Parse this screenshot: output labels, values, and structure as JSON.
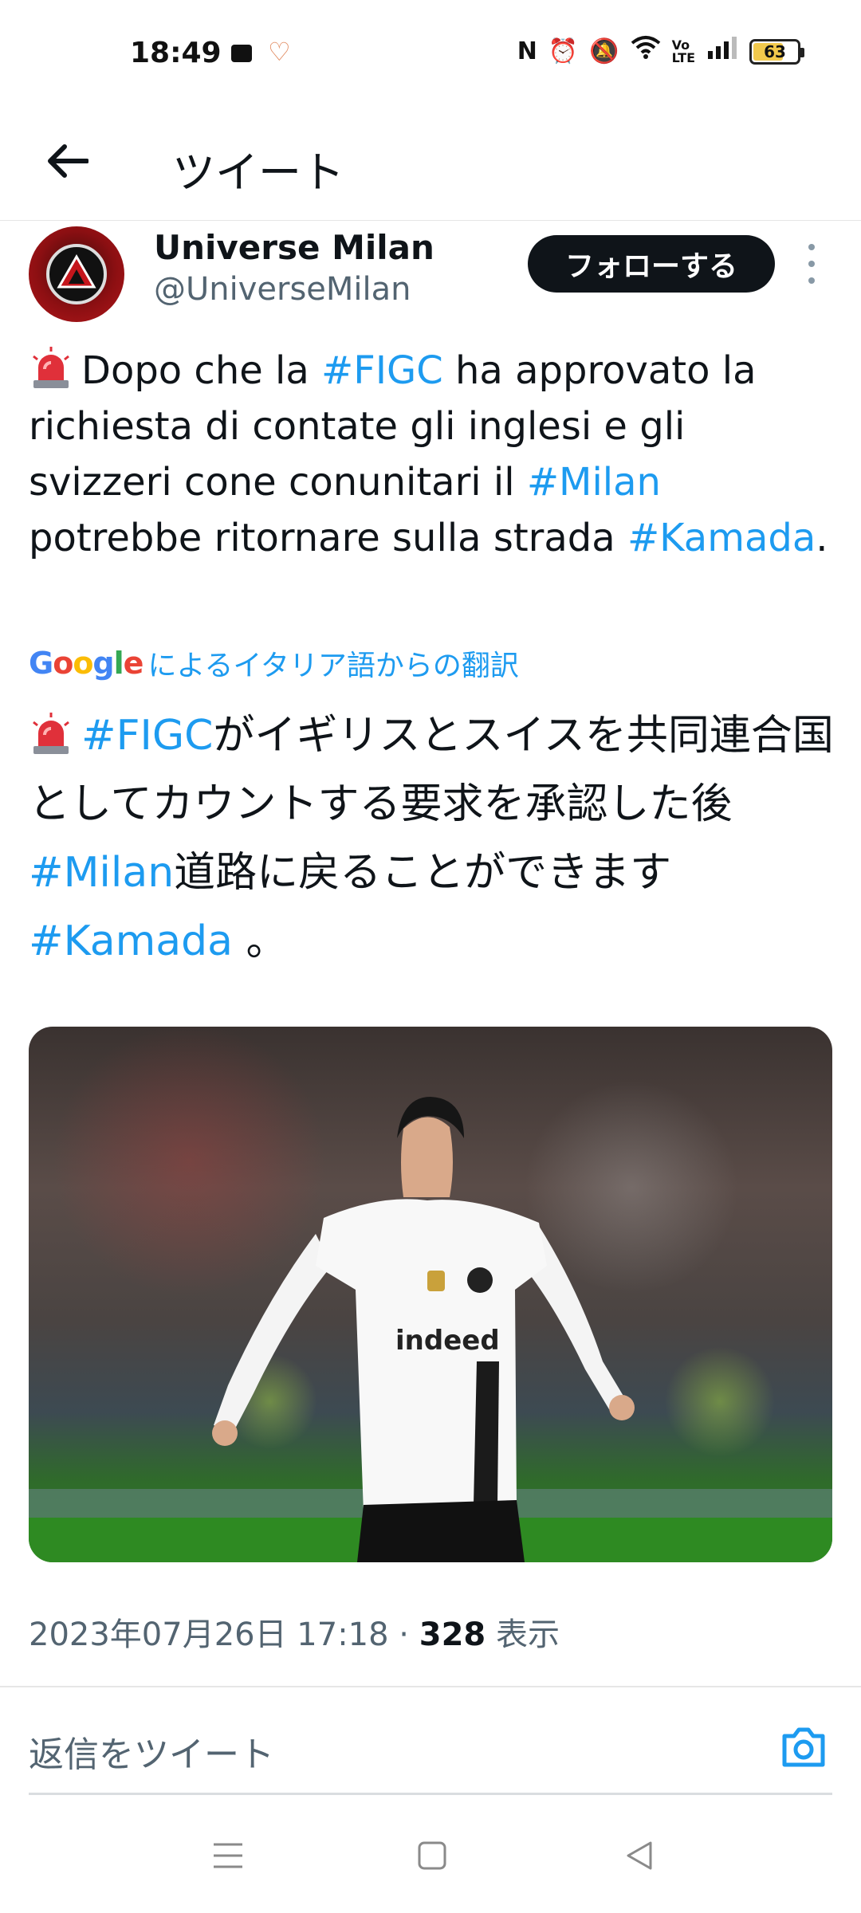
{
  "status_bar": {
    "time": "18:49",
    "battery": "63",
    "battery_level": 0.63
  },
  "header": {
    "title": "ツイート",
    "back_icon": "arrow-left-icon"
  },
  "tweet": {
    "author": {
      "name": "Universe Milan",
      "handle": "@UniverseMilan"
    },
    "follow_label": "フォローする",
    "text": {
      "p1": "Dopo che la ",
      "tag_figc": "#FIGC",
      "p2": " ha approvato la richiesta di contate gli inglesi e gli svizzeri cone conunitari il ",
      "tag_milan": "#Milan",
      "p3": " potrebbe ritornare sulla strada ",
      "tag_kamada": "#Kamada",
      "p4": "."
    },
    "translation_label": "によるイタリア語からの翻訳",
    "google_logo": [
      "G",
      "o",
      "o",
      "g",
      "l",
      "e"
    ],
    "translated": {
      "tag_figc": "#FIGC",
      "p1": "がイギリスとスイスを共同連合国としてカウントする要求を承認した後",
      "tag_milan": "#Milan",
      "p2": "道路に戻ることができます",
      "tag_kamada": "#Kamada",
      "p3": " 。"
    },
    "meta": {
      "datetime": "2023年07月26日 17:18",
      "separator": " · ",
      "views": "328",
      "views_label": " 表示"
    }
  },
  "reply": {
    "placeholder": "返信をツイート"
  },
  "colors": {
    "accent": "#1d9bf0",
    "text": "#0f1419",
    "muted": "#536471"
  }
}
